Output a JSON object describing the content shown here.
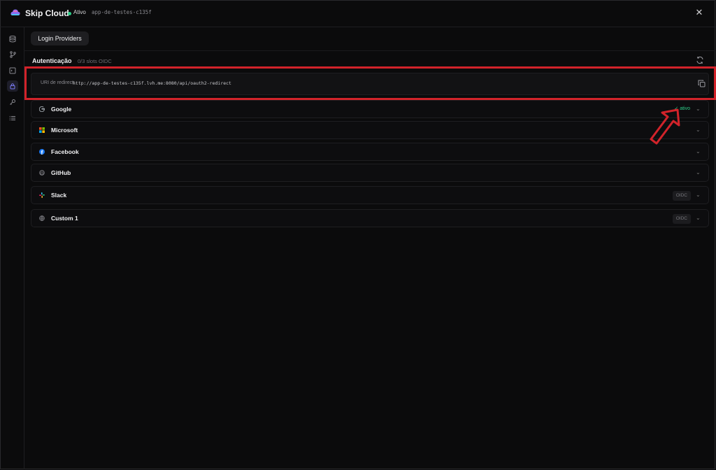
{
  "header": {
    "app_title": "Skip Cloud",
    "status_text": "Ativo",
    "project_id": "app-de-testes-c135f",
    "close_symbol": "✕"
  },
  "sidebar": {
    "items": [
      {
        "icon": "database-icon"
      },
      {
        "icon": "git-branch-icon"
      },
      {
        "icon": "terminal-icon"
      },
      {
        "icon": "lock-icon",
        "active": true
      },
      {
        "icon": "key-icon"
      },
      {
        "icon": "list-icon"
      }
    ]
  },
  "tab": {
    "label": "Login Providers"
  },
  "auth": {
    "title": "Autenticação",
    "subtitle": "0/3 slots OIDC",
    "redirect_label": "URI de redirect:",
    "redirect_url": "http://app-de-testes-c135f.lvh.me:8080/api/oauth2-redirect"
  },
  "providers": [
    {
      "name": "Google",
      "status": "✓ ativo",
      "icon": "google-icon"
    },
    {
      "name": "Microsoft",
      "icon": "microsoft-icon"
    },
    {
      "name": "Facebook",
      "icon": "facebook-icon"
    },
    {
      "name": "GitHub",
      "icon": "github-icon"
    },
    {
      "name": "Slack",
      "badge": "OIDC",
      "icon": "slack-icon"
    },
    {
      "name": "Custom 1",
      "badge": "OIDC",
      "icon": "globe-icon"
    }
  ],
  "colors": {
    "accent_green": "#2ecf8a",
    "highlight_red": "#d2232a",
    "background": "#0b0b0c"
  }
}
